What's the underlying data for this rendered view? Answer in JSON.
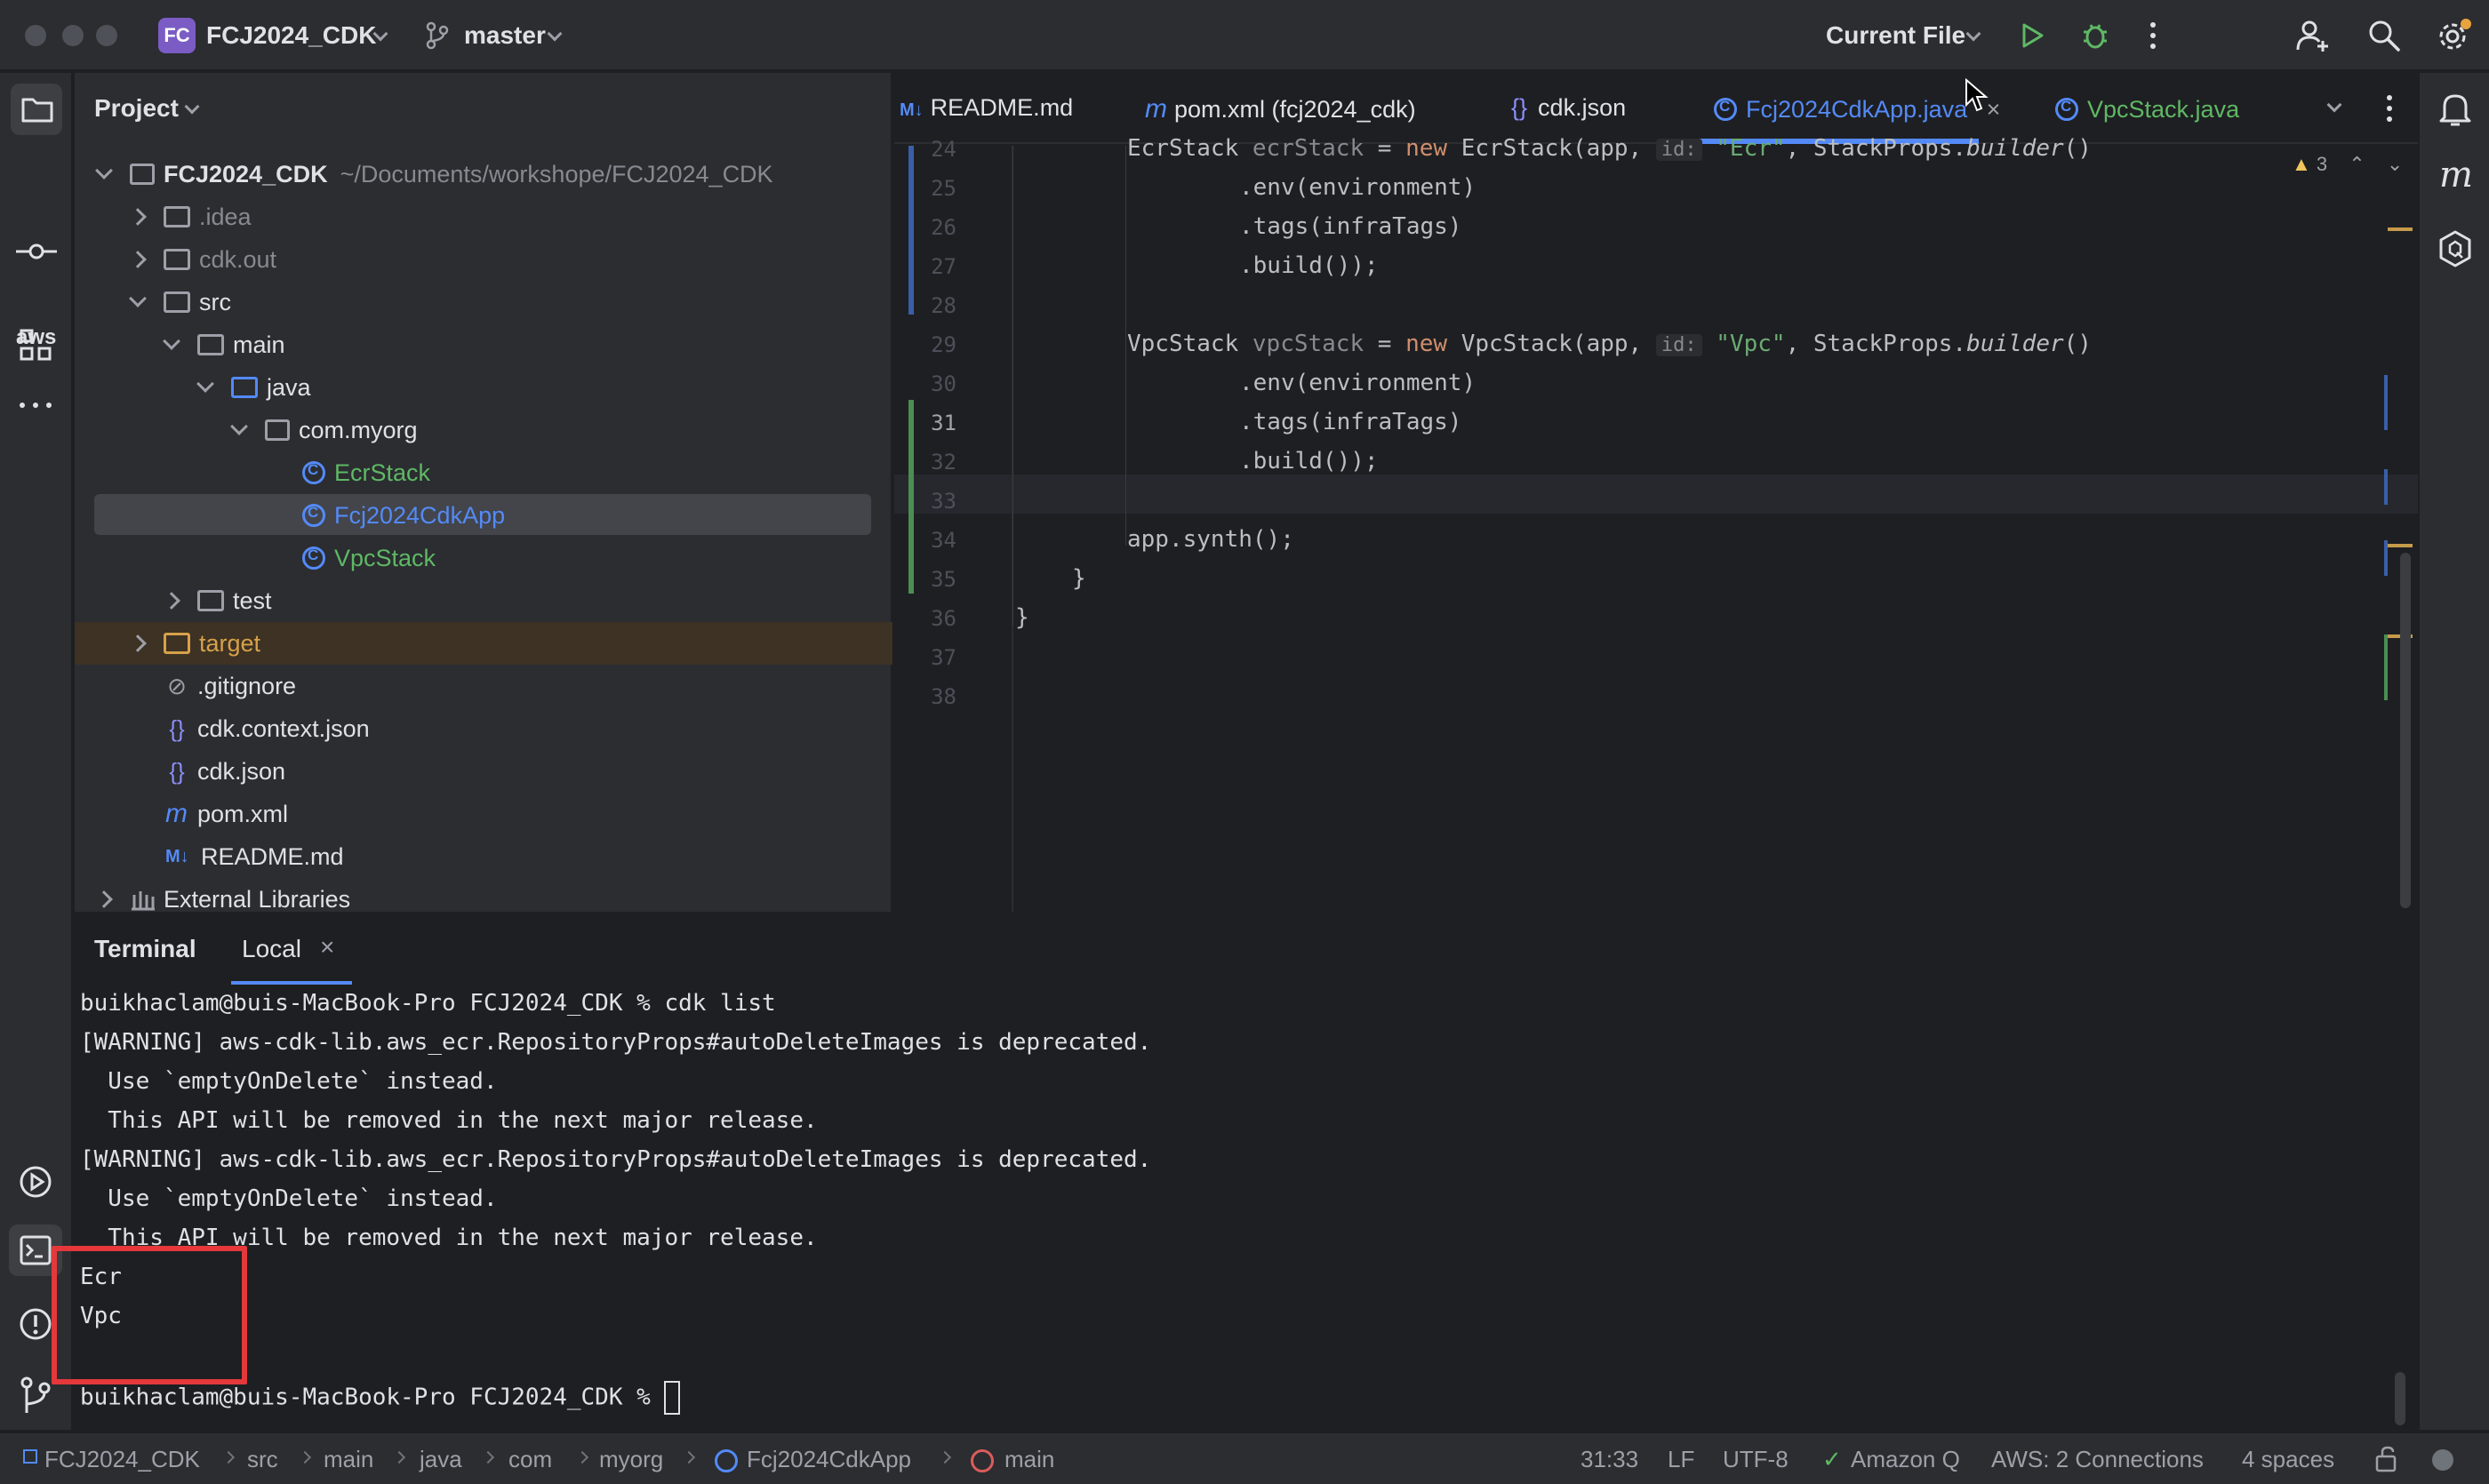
{
  "titlebar": {
    "project_badge": "FC",
    "project_name": "FCJ2024_CDK",
    "branch": "master",
    "run_config": "Current File"
  },
  "project_panel": {
    "title": "Project",
    "root_name": "FCJ2024_CDK",
    "root_path": "~/Documents/workshope/FCJ2024_CDK",
    "items": [
      {
        "label": ".idea"
      },
      {
        "label": "cdk.out"
      },
      {
        "label": "src"
      },
      {
        "label": "main"
      },
      {
        "label": "java"
      },
      {
        "label": "com.myorg"
      },
      {
        "label": "EcrStack"
      },
      {
        "label": "Fcj2024CdkApp"
      },
      {
        "label": "VpcStack"
      },
      {
        "label": "test"
      },
      {
        "label": "target"
      },
      {
        "label": ".gitignore"
      },
      {
        "label": "cdk.context.json"
      },
      {
        "label": "cdk.json"
      },
      {
        "label": "pom.xml"
      },
      {
        "label": "README.md"
      },
      {
        "label": "External Libraries"
      }
    ]
  },
  "editor": {
    "tabs": [
      {
        "label": "README.md"
      },
      {
        "label": "pom.xml (fcj2024_cdk)"
      },
      {
        "label": "cdk.json"
      },
      {
        "label": "Fcj2024CdkApp.java"
      },
      {
        "label": "VpcStack.java"
      }
    ],
    "warnings_count": "3",
    "line_numbers": [
      "24",
      "25",
      "26",
      "27",
      "28",
      "29",
      "30",
      "31",
      "32",
      "33",
      "34",
      "35",
      "36",
      "37",
      "38"
    ],
    "code": {
      "l24_type": "EcrStack ",
      "l24_var": "ecrStack",
      "l24_eq": " = ",
      "l24_new": "new",
      "l24_call": " EcrStack(app, ",
      "l24_hint": "id:",
      "l24_str": "\"Ecr\"",
      "l24_rest": ", StackProps.",
      "l24_builder": "builder",
      "l24_end": "()",
      "l25": ".env(environment)",
      "l26": ".tags(infraTags)",
      "l27": ".build());",
      "l29_type": "VpcStack ",
      "l29_var": "vpcStack",
      "l29_eq": " = ",
      "l29_new": "new",
      "l29_call": " VpcStack(app, ",
      "l29_hint": "id:",
      "l29_str": "\"Vpc\"",
      "l29_rest": ", StackProps.",
      "l29_builder": "builder",
      "l29_end": "()",
      "l30": ".env(environment)",
      "l31": ".tags(infraTags)",
      "l32": ".build());",
      "l34_obj": "app.",
      "l34_fn": "synth",
      "l34_end": "();",
      "l35": "}",
      "l36": "}"
    }
  },
  "terminal": {
    "tab_title": "Terminal",
    "session_tab": "Local",
    "lines": [
      "buikhaclam@buis-MacBook-Pro FCJ2024_CDK % cdk list",
      "[WARNING] aws-cdk-lib.aws_ecr.RepositoryProps#autoDeleteImages is deprecated.",
      "  Use `emptyOnDelete` instead.",
      "  This API will be removed in the next major release.",
      "[WARNING] aws-cdk-lib.aws_ecr.RepositoryProps#autoDeleteImages is deprecated.",
      "  Use `emptyOnDelete` instead.",
      "  This API will be removed in the next major release.",
      "Ecr",
      "Vpc",
      "",
      "buikhaclam@buis-MacBook-Pro FCJ2024_CDK % "
    ],
    "highlight_color": "#e5383b"
  },
  "statusbar": {
    "breadcrumbs": [
      "FCJ2024_CDK",
      "src",
      "main",
      "java",
      "com",
      "myorg",
      "Fcj2024CdkApp",
      "main"
    ],
    "position": "31:33",
    "line_sep": "LF",
    "encoding": "UTF-8",
    "amazon_q": "Amazon Q",
    "aws": "AWS: 2 Connections",
    "indent": "4 spaces"
  },
  "colors": {
    "accent": "#548af7",
    "selected_row": "#43454a",
    "target_row": "#3d3223",
    "run_green": "#5fb865",
    "warning": "#f2c55c"
  }
}
